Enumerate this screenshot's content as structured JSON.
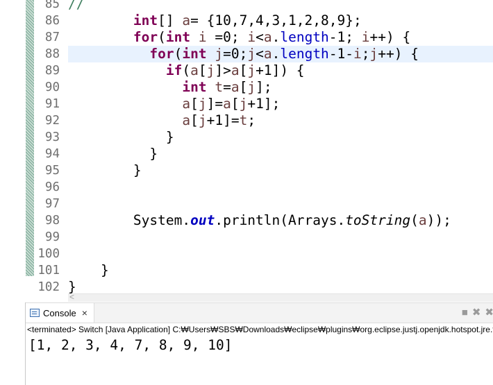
{
  "editor": {
    "highlighted_line": "88",
    "lines": [
      {
        "num": "85",
        "tokens": [
          {
            "t": "//",
            "c": "cmt"
          }
        ]
      },
      {
        "num": "86",
        "tokens": [
          {
            "t": "        "
          },
          {
            "t": "int",
            "c": "kw"
          },
          {
            "t": "[] "
          },
          {
            "t": "a",
            "c": "var"
          },
          {
            "t": "= {10,7,4,3,1,2,8,9};"
          }
        ]
      },
      {
        "num": "87",
        "tokens": [
          {
            "t": "        "
          },
          {
            "t": "for",
            "c": "kw"
          },
          {
            "t": "("
          },
          {
            "t": "int",
            "c": "kw"
          },
          {
            "t": " "
          },
          {
            "t": "i",
            "c": "var"
          },
          {
            "t": " =0; "
          },
          {
            "t": "i",
            "c": "var"
          },
          {
            "t": "<"
          },
          {
            "t": "a",
            "c": "var"
          },
          {
            "t": "."
          },
          {
            "t": "length",
            "c": "fld-n"
          },
          {
            "t": "-1; "
          },
          {
            "t": "i",
            "c": "var"
          },
          {
            "t": "++) {"
          }
        ]
      },
      {
        "num": "88",
        "tokens": [
          {
            "t": "          "
          },
          {
            "t": "for",
            "c": "kw"
          },
          {
            "t": "("
          },
          {
            "t": "int",
            "c": "kw"
          },
          {
            "t": " "
          },
          {
            "t": "j",
            "c": "var"
          },
          {
            "t": "=0;"
          },
          {
            "t": "j",
            "c": "var"
          },
          {
            "t": "<"
          },
          {
            "t": "a",
            "c": "var"
          },
          {
            "t": "."
          },
          {
            "t": "length",
            "c": "fld-n"
          },
          {
            "t": "-1-"
          },
          {
            "t": "i",
            "c": "var"
          },
          {
            "t": ";"
          },
          {
            "t": "j",
            "c": "var"
          },
          {
            "t": "++) {"
          }
        ]
      },
      {
        "num": "89",
        "tokens": [
          {
            "t": "            "
          },
          {
            "t": "if",
            "c": "kw"
          },
          {
            "t": "("
          },
          {
            "t": "a",
            "c": "var"
          },
          {
            "t": "["
          },
          {
            "t": "j",
            "c": "var"
          },
          {
            "t": "]>"
          },
          {
            "t": "a",
            "c": "var"
          },
          {
            "t": "["
          },
          {
            "t": "j",
            "c": "var"
          },
          {
            "t": "+1]) {"
          }
        ]
      },
      {
        "num": "90",
        "tokens": [
          {
            "t": "              "
          },
          {
            "t": "int",
            "c": "kw"
          },
          {
            "t": " "
          },
          {
            "t": "t",
            "c": "var"
          },
          {
            "t": "="
          },
          {
            "t": "a",
            "c": "var"
          },
          {
            "t": "["
          },
          {
            "t": "j",
            "c": "var"
          },
          {
            "t": "];"
          }
        ]
      },
      {
        "num": "91",
        "tokens": [
          {
            "t": "              "
          },
          {
            "t": "a",
            "c": "var"
          },
          {
            "t": "["
          },
          {
            "t": "j",
            "c": "var"
          },
          {
            "t": "]="
          },
          {
            "t": "a",
            "c": "var"
          },
          {
            "t": "["
          },
          {
            "t": "j",
            "c": "var"
          },
          {
            "t": "+1];"
          }
        ]
      },
      {
        "num": "92",
        "tokens": [
          {
            "t": "              "
          },
          {
            "t": "a",
            "c": "var"
          },
          {
            "t": "["
          },
          {
            "t": "j",
            "c": "var"
          },
          {
            "t": "+1]="
          },
          {
            "t": "t",
            "c": "var"
          },
          {
            "t": ";"
          }
        ]
      },
      {
        "num": "93",
        "tokens": [
          {
            "t": "            }"
          }
        ]
      },
      {
        "num": "94",
        "tokens": [
          {
            "t": "          }"
          }
        ]
      },
      {
        "num": "95",
        "tokens": [
          {
            "t": "        }"
          }
        ]
      },
      {
        "num": "96",
        "tokens": []
      },
      {
        "num": "97",
        "tokens": []
      },
      {
        "num": "98",
        "tokens": [
          {
            "t": "        System."
          },
          {
            "t": "out",
            "c": "fld"
          },
          {
            "t": ".println(Arrays."
          },
          {
            "t": "toString",
            "c": "it"
          },
          {
            "t": "("
          },
          {
            "t": "a",
            "c": "var"
          },
          {
            "t": "));"
          }
        ]
      },
      {
        "num": "99",
        "tokens": []
      },
      {
        "num": "100",
        "tokens": []
      },
      {
        "num": "101",
        "tokens": [
          {
            "t": "    }"
          }
        ]
      },
      {
        "num": "102",
        "tokens": [
          {
            "t": "}"
          }
        ]
      }
    ]
  },
  "console": {
    "tab_label": "Console",
    "close_glyph": "×",
    "status_text": "<terminated> Switch [Java Application] C:₩Users₩SBS₩Downloads₩eclipse₩plugins₩org.eclipse.justj.openjdk.hotspot.jre.ful",
    "output": "[1, 2, 3, 4, 7, 8, 9, 10]",
    "toolbar": [
      {
        "name": "terminate-icon",
        "glyph": "■"
      },
      {
        "name": "remove-launch-icon",
        "glyph": "✖"
      },
      {
        "name": "remove-all-icon",
        "glyph": "✖"
      }
    ]
  },
  "colors": {
    "keyword": "#7f0055",
    "variable": "#6a3e3e",
    "field": "#0000c0",
    "comment": "#3f7f5f",
    "current_line": "#e8f2fe"
  }
}
